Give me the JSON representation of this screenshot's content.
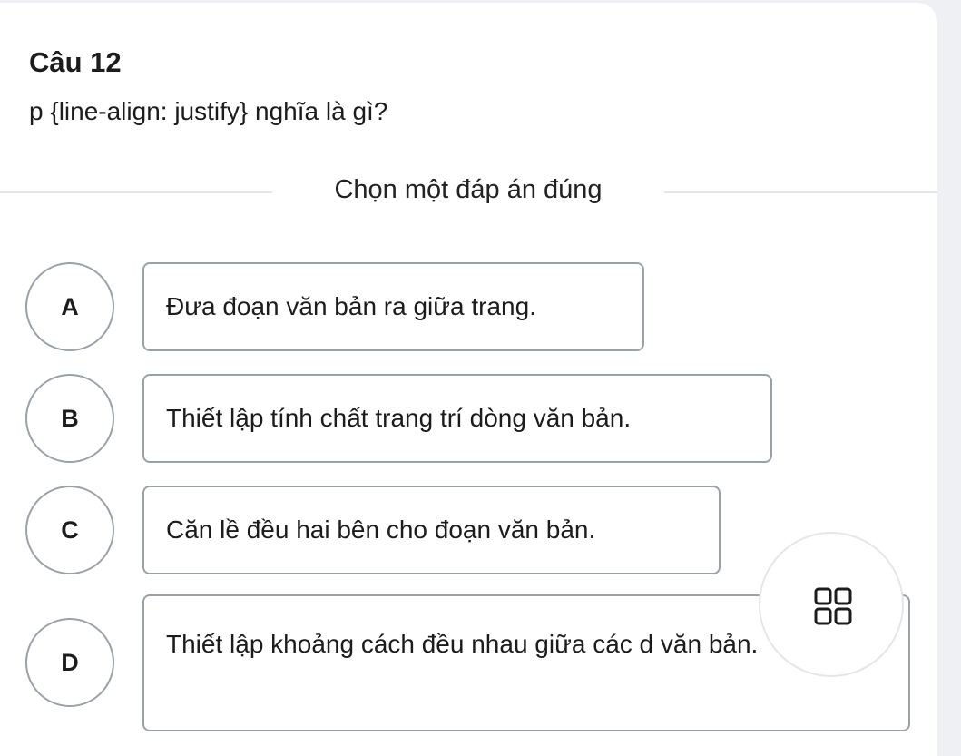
{
  "question": {
    "title": "Câu 12",
    "text": "p {line-align: justify} nghĩa là gì?"
  },
  "instruction": "Chọn một đáp án đúng",
  "options": [
    {
      "letter": "A",
      "text": "Đưa đoạn văn bản ra giữa trang."
    },
    {
      "letter": "B",
      "text": "Thiết lập tính chất trang trí dòng văn bản."
    },
    {
      "letter": "C",
      "text": "Căn lề đều hai bên cho đoạn văn bản."
    },
    {
      "letter": "D",
      "text": "Thiết lập khoảng cách đều nhau giữa các d văn bản."
    }
  ],
  "floating_button": {
    "icon": "grid-icon"
  }
}
